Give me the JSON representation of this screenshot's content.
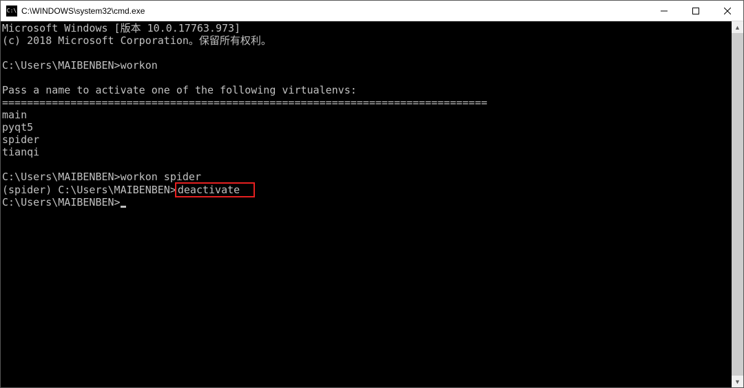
{
  "titlebar": {
    "icon_label": "cmd-icon",
    "icon_text": "C:\\",
    "title": "C:\\WINDOWS\\system32\\cmd.exe"
  },
  "terminal": {
    "line1": "Microsoft Windows [版本 10.0.17763.973]",
    "line2": "(c) 2018 Microsoft Corporation。保留所有权利。",
    "blank1": "",
    "prompt1_path": "C:\\Users\\MAIBENBEN>",
    "prompt1_cmd": "workon",
    "blank2": "",
    "msg": "Pass a name to activate one of the following virtualenvs:",
    "sep": "==============================================================================",
    "env1": "main",
    "env2": "pyqt5",
    "env3": "spider",
    "env4": "tianqi",
    "blank3": "",
    "prompt2_path": "C:\\Users\\MAIBENBEN>",
    "prompt2_cmd": "workon spider",
    "prompt3_prefix": "(spider) C:\\Users\\MAIBENBEN>",
    "prompt3_cmd": "deactivate",
    "prompt4_path": "C:\\Users\\MAIBENBEN>"
  }
}
